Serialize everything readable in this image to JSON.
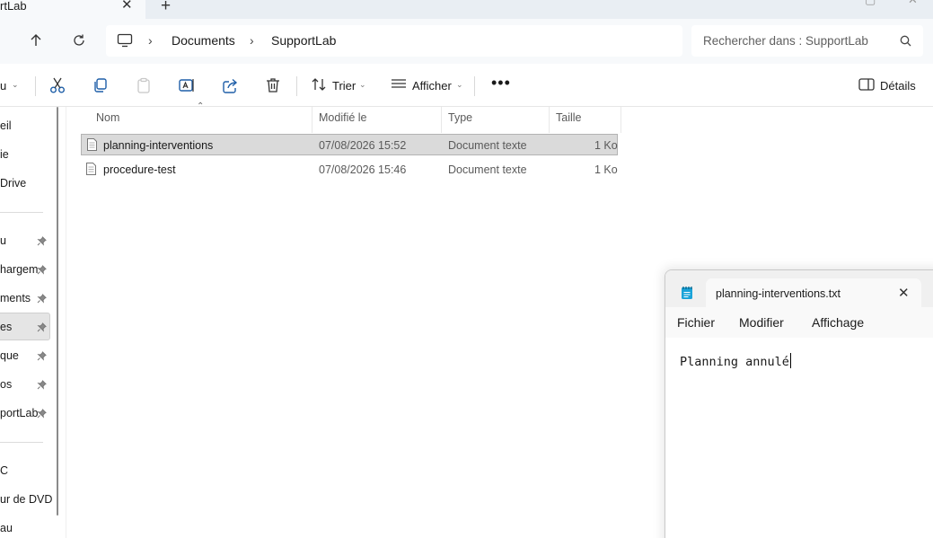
{
  "explorer": {
    "tab": {
      "title": "rtLab",
      "close_glyph": "✕",
      "add_glyph": "+"
    },
    "breadcrumb": [
      "Documents",
      "SupportLab"
    ],
    "search": {
      "placeholder": "Rechercher dans : SupportLab"
    },
    "toolbar": {
      "new_label": "u",
      "sort_label": "Trier",
      "view_label": "Afficher",
      "more_label": "•••",
      "details_label": "Détails",
      "icons": [
        "cut-icon",
        "copy-icon",
        "paste-icon",
        "rename-icon",
        "share-icon",
        "delete-icon"
      ]
    },
    "nav": {
      "items": [
        {
          "label": "eil",
          "pinned": false
        },
        {
          "label": "ie",
          "pinned": false
        },
        {
          "label": "Drive",
          "pinned": false
        },
        {
          "label": "u",
          "pinned": true
        },
        {
          "label": "hargem",
          "pinned": true
        },
        {
          "label": "ments",
          "pinned": true
        },
        {
          "label": "es",
          "pinned": true,
          "selected": true
        },
        {
          "label": "que",
          "pinned": true
        },
        {
          "label": "os",
          "pinned": true
        },
        {
          "label": "portLab",
          "pinned": true
        },
        {
          "label": "C",
          "pinned": false
        },
        {
          "label": "ur de DVD",
          "pinned": false
        },
        {
          "label": "au",
          "pinned": false
        }
      ],
      "pin_glyph": "📌"
    },
    "columns": {
      "name": "Nom",
      "modified": "Modifié le",
      "type": "Type",
      "size": "Taille"
    },
    "files": [
      {
        "name": "planning-interventions",
        "modified": "07/08/2026 15:52",
        "type": "Document texte",
        "size": "1 Ko",
        "selected": true
      },
      {
        "name": "procedure-test",
        "modified": "07/08/2026 15:46",
        "type": "Document texte",
        "size": "1 Ko",
        "selected": false
      }
    ]
  },
  "notepad": {
    "tab_title": "planning-interventions.txt",
    "close_glyph": "✕",
    "menu": [
      "Fichier",
      "Modifier",
      "Affichage"
    ],
    "content": "Planning annulé"
  }
}
